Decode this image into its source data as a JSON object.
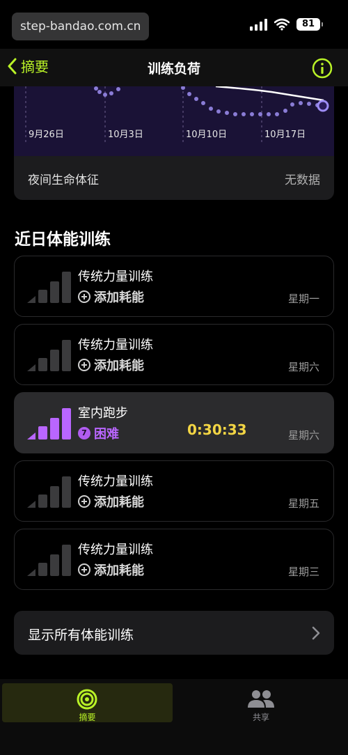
{
  "watermark": "step-bandao.com.cn",
  "status": {
    "battery": "81"
  },
  "nav": {
    "back_label": "摘要",
    "title": "训练负荷"
  },
  "chart": {
    "x_ticks": [
      "9月26日",
      "10月3日",
      "10月10日",
      "10月17日"
    ]
  },
  "vitals": {
    "label": "夜间生命体征",
    "value": "无数据"
  },
  "section_title": "近日体能训练",
  "workouts": [
    {
      "name": "传统力量训练",
      "sub": "添加耗能",
      "day": "星期一",
      "duration": "",
      "effort": ""
    },
    {
      "name": "传统力量训练",
      "sub": "添加耗能",
      "day": "星期六",
      "duration": "",
      "effort": ""
    },
    {
      "name": "室内跑步",
      "sub": "困难",
      "day": "星期六",
      "duration": "0:30:33",
      "effort": "7"
    },
    {
      "name": "传统力量训练",
      "sub": "添加耗能",
      "day": "星期五",
      "duration": "",
      "effort": ""
    },
    {
      "name": "传统力量训练",
      "sub": "添加耗能",
      "day": "星期三",
      "duration": "",
      "effort": ""
    }
  ],
  "show_all_label": "显示所有体能训练",
  "tabs": [
    {
      "label": "摘要",
      "icon": "activity-rings-icon",
      "selected": true
    },
    {
      "label": "共享",
      "icon": "people-icon",
      "selected": false
    }
  ],
  "colors": {
    "accent": "#b9f227",
    "effort": "#b966ff",
    "duration": "#f2d544",
    "chart_bg": "#1a1236"
  }
}
